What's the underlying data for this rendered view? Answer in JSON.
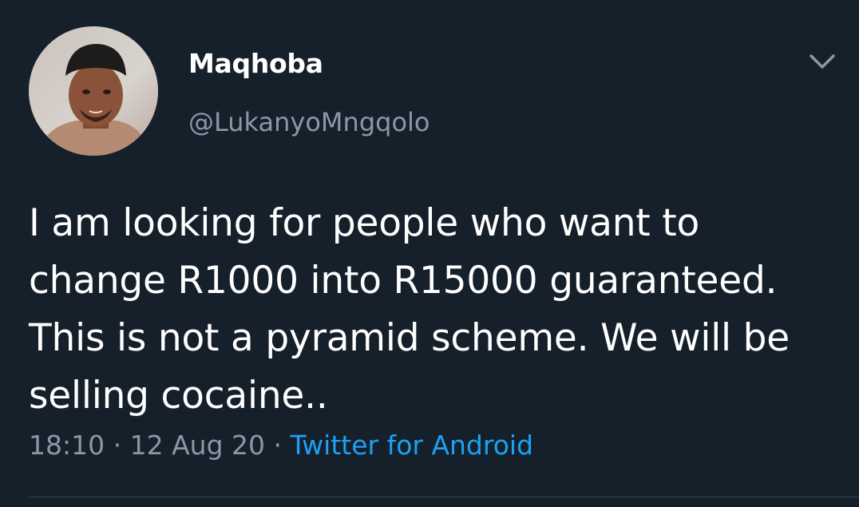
{
  "user": {
    "display_name": "Maqhoba",
    "handle": "@LukanyoMngqolo",
    "avatar_icon": "user-avatar-photo"
  },
  "tweet": {
    "text": "I am looking for people who want to\nchange R1000 into R15000 guaranteed.\nThis is not a pyramid scheme. We will be\nselling cocaine..",
    "time": "18:10",
    "separator": " · ",
    "date": "12 Aug 20",
    "source": "Twitter for Android"
  },
  "colors": {
    "background": "#15202b",
    "primary_text": "#ffffff",
    "secondary_text": "#8899a6",
    "link": "#1da1f2"
  },
  "icons": {
    "menu": "chevron-down-icon"
  }
}
